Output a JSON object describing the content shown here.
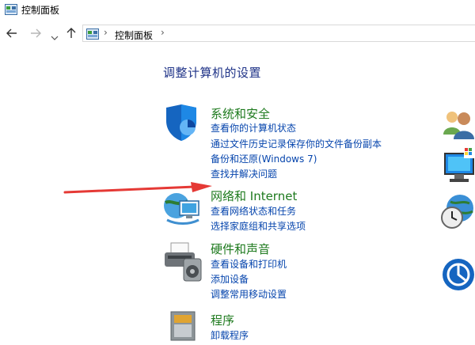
{
  "window": {
    "title": "控制面板"
  },
  "address": {
    "crumb": "控制面板",
    "separator": "›"
  },
  "main": {
    "heading": "调整计算机的设置",
    "categories": [
      {
        "title": "系统和安全",
        "links": [
          "查看你的计算机状态",
          "通过文件历史记录保存你的文件备份副本",
          "备份和还原(Windows 7)",
          "查找并解决问题"
        ]
      },
      {
        "title": "网络和 Internet",
        "links": [
          "查看网络状态和任务",
          "选择家庭组和共享选项"
        ]
      },
      {
        "title": "硬件和声音",
        "links": [
          "查看设备和打印机",
          "添加设备",
          "调整常用移动设置"
        ]
      },
      {
        "title": "程序",
        "links": [
          "卸载程序"
        ]
      }
    ]
  },
  "colors": {
    "category_title": "#1e7a1e",
    "link": "#0645ad",
    "heading": "#1e3287",
    "annotation_arrow": "#e53935"
  }
}
